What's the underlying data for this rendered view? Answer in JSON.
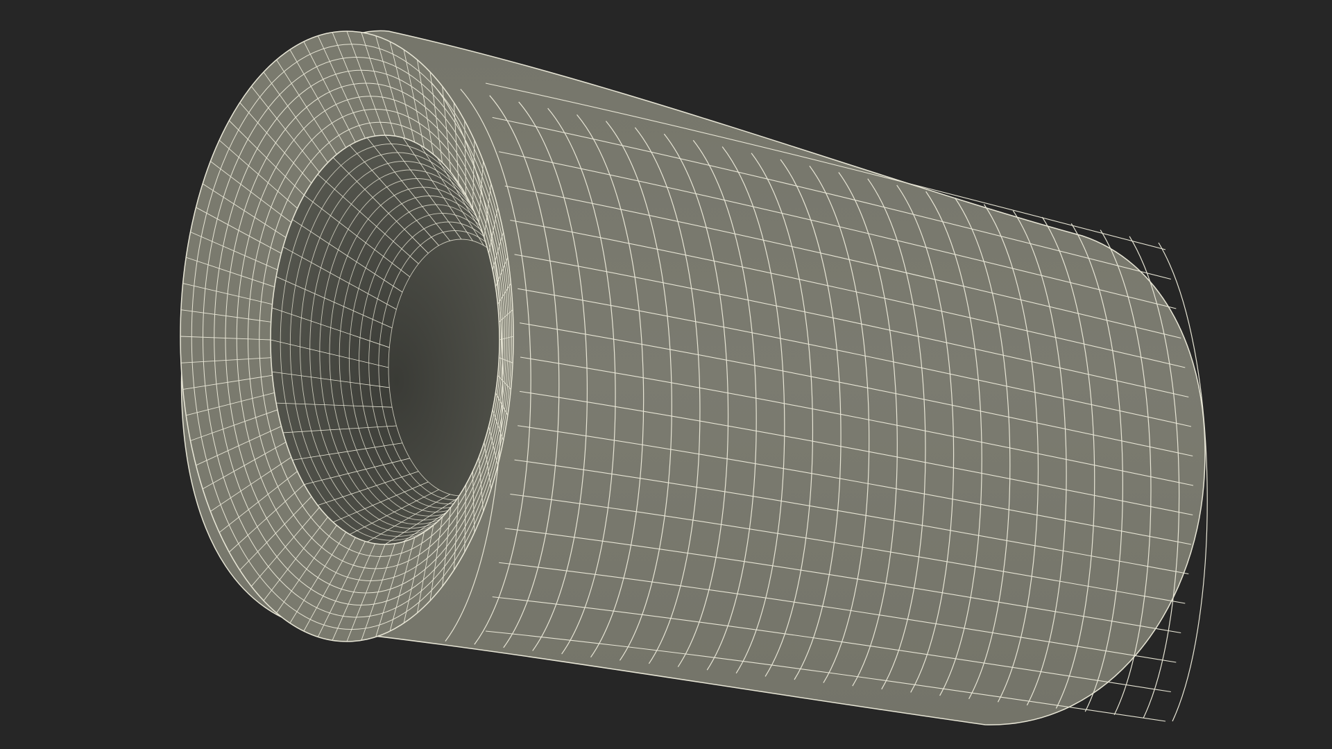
{
  "scene": {
    "background_color": "#262626",
    "model": {
      "description_icon": "wireframe-tube-mesh",
      "surface_color": "#7a7a6e",
      "inner_color": "#444540",
      "wire_color": "#e8e6d6"
    }
  }
}
